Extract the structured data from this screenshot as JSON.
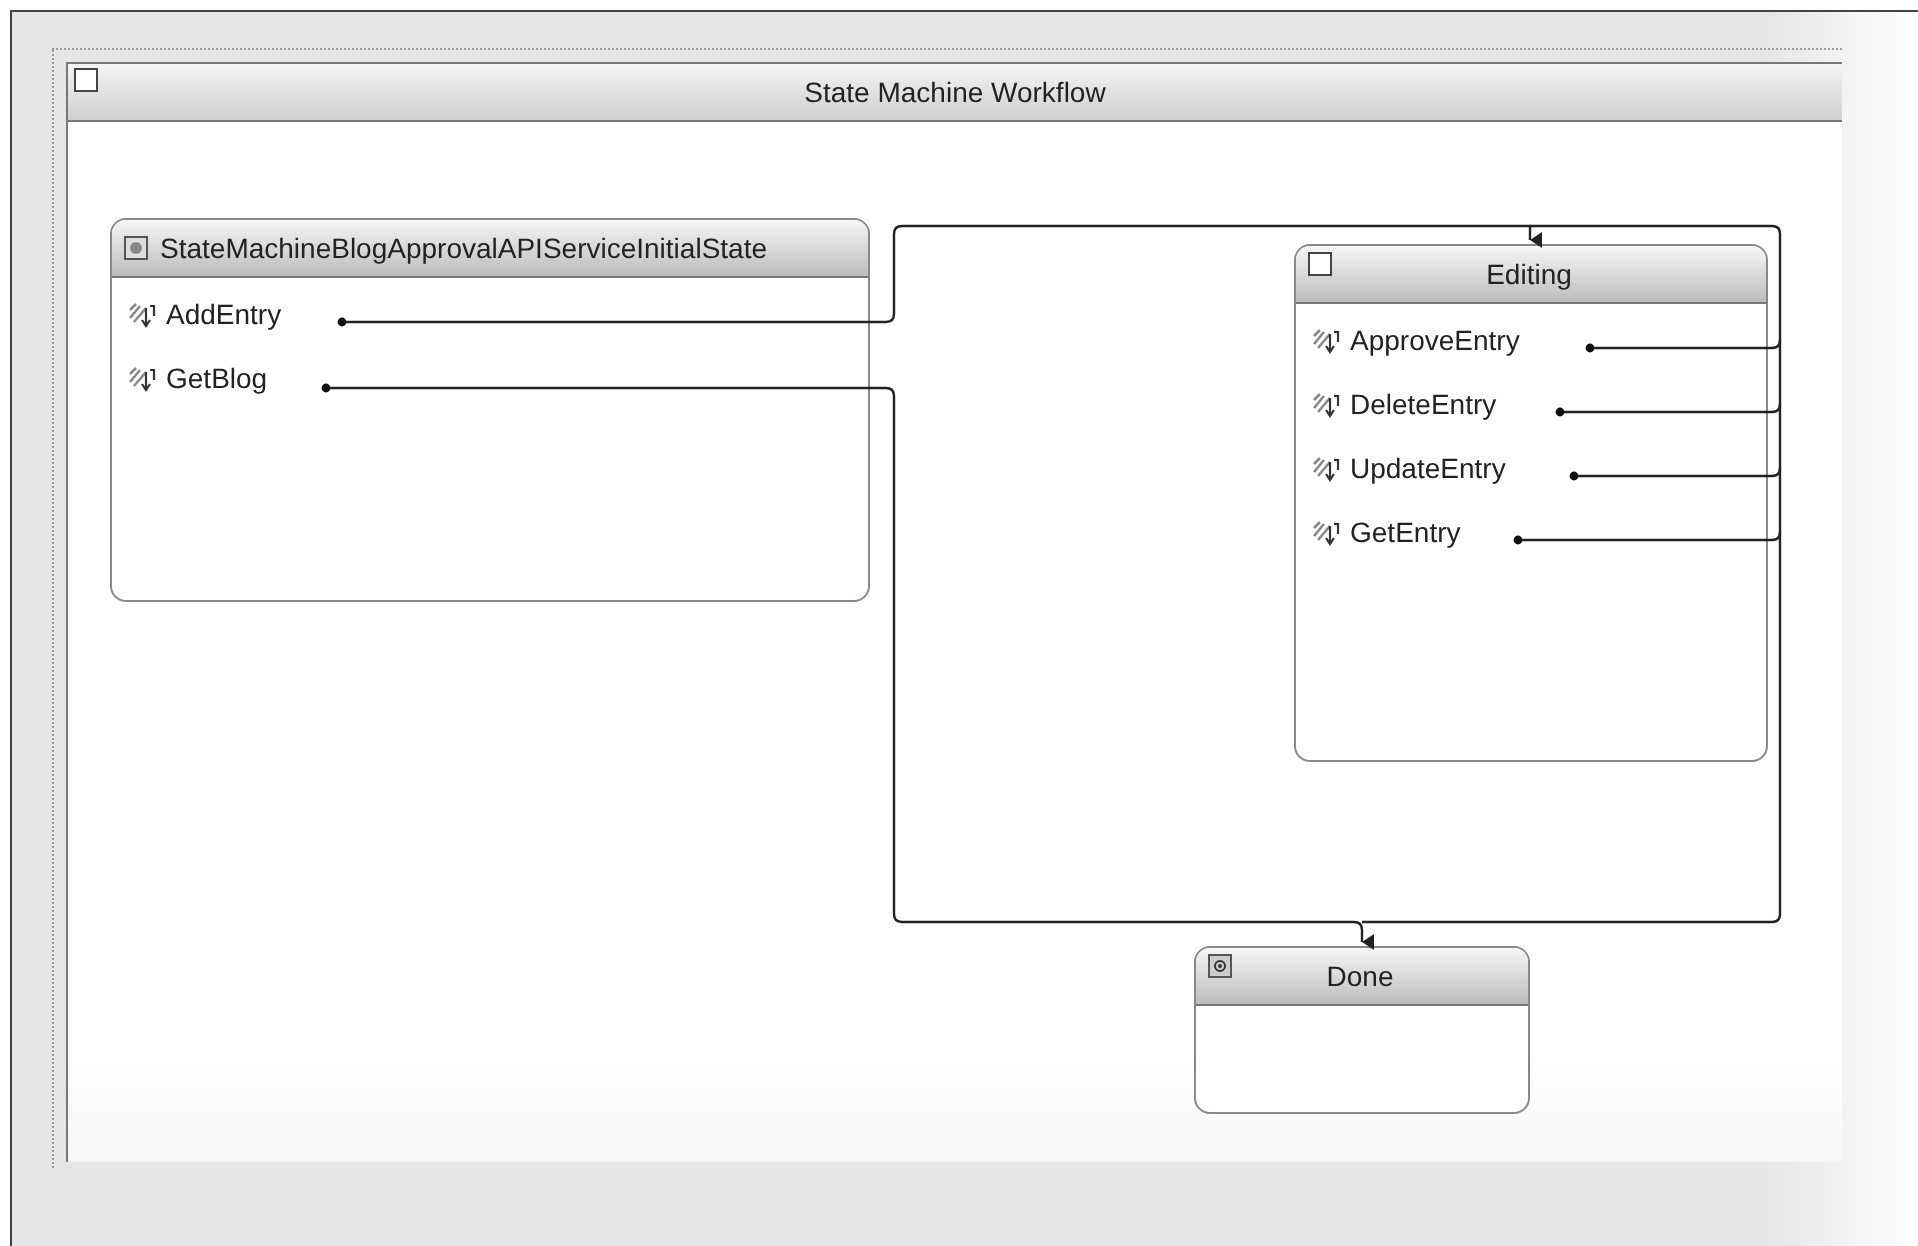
{
  "workflow": {
    "title": "State Machine Workflow"
  },
  "states": [
    {
      "kind": "initial",
      "title": "StateMachineBlogApprovalAPIServiceInitialState",
      "events": [
        "AddEntry",
        "GetBlog"
      ]
    },
    {
      "kind": "normal",
      "title": "Editing",
      "events": [
        "ApproveEntry",
        "DeleteEntry",
        "UpdateEntry",
        "GetEntry"
      ]
    },
    {
      "kind": "final",
      "title": "Done"
    }
  ]
}
